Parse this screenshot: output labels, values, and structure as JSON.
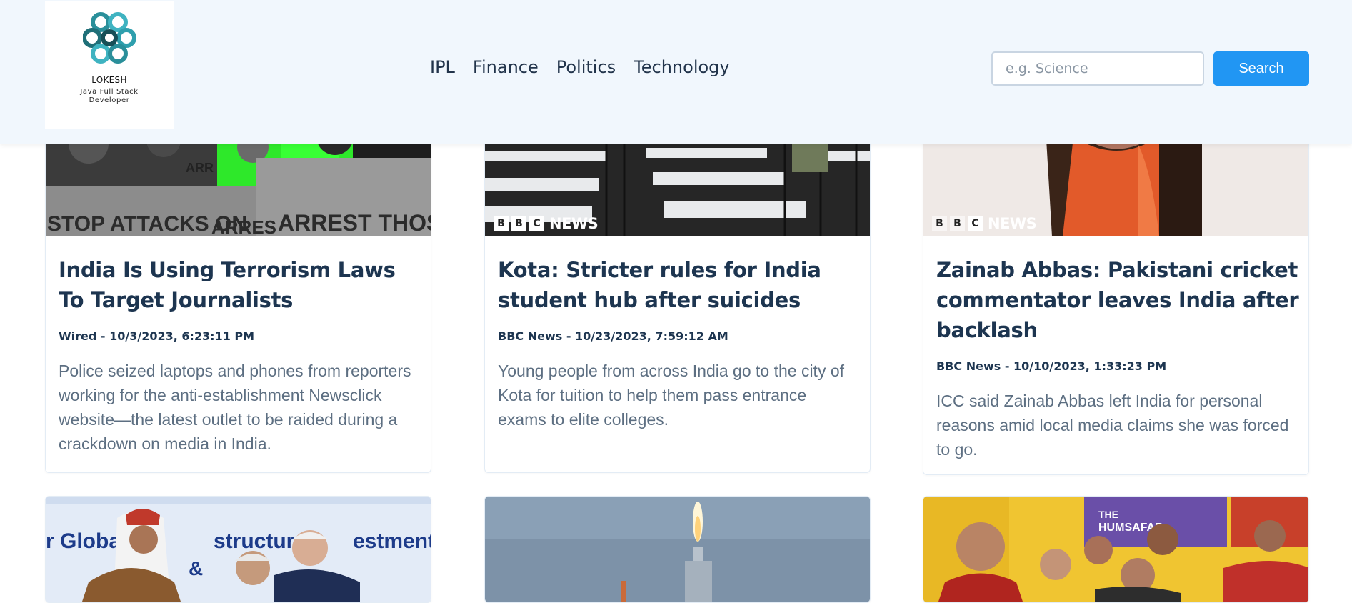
{
  "brand": {
    "name": "LOKESH",
    "tagline": "Java Full Stack Developer"
  },
  "nav": {
    "items": [
      "IPL",
      "Finance",
      "Politics",
      "Technology"
    ]
  },
  "search": {
    "placeholder": "e.g. Science",
    "value": "",
    "button_label": "Search"
  },
  "articles": [
    {
      "title": "India Is Using Terrorism Laws To Target Journalists",
      "meta": "Wired - 10/3/2023, 6:23:11 PM",
      "description": "Police seized laptops and phones from reporters working for the anti-establishment Newsclick website—the latest outlet to be raided during a crackdown on media in India.",
      "image_text": [
        "STOP ATTACKS ON",
        "ARRES",
        "ARREST THOSE",
        "ARR"
      ]
    },
    {
      "title": "Kota: Stricter rules for India student hub after suicides",
      "meta": "BBC News - 10/23/2023, 7:59:12 AM",
      "description": "Young people from across India go to the city of Kota for tuition to help them pass entrance exams to elite colleges.",
      "image_badge": [
        "B",
        "B",
        "C",
        "NEWS"
      ]
    },
    {
      "title": "Zainab Abbas: Pakistani cricket commentator leaves India after backlash",
      "meta": "BBC News - 10/10/2023, 1:33:23 PM",
      "description": "ICC said Zainab Abbas left India for personal reasons amid local media claims she was forced to go.",
      "image_badge": [
        "B",
        "B",
        "C",
        "NEWS"
      ]
    },
    {
      "image_text": [
        "r Global",
        "structure",
        "estment",
        "&"
      ]
    },
    {},
    {
      "image_text": [
        "THE",
        "HUMSAFAR"
      ]
    }
  ],
  "colors": {
    "accent": "#2196f3",
    "header_bg": "#f1f7fd",
    "title": "#1d3550",
    "body_text": "#5d6f82",
    "nav_text": "#22344b"
  },
  "icons": {
    "logo": "interlocking-rings-logo-icon",
    "bbc": "bbc-news-badge-icon"
  }
}
